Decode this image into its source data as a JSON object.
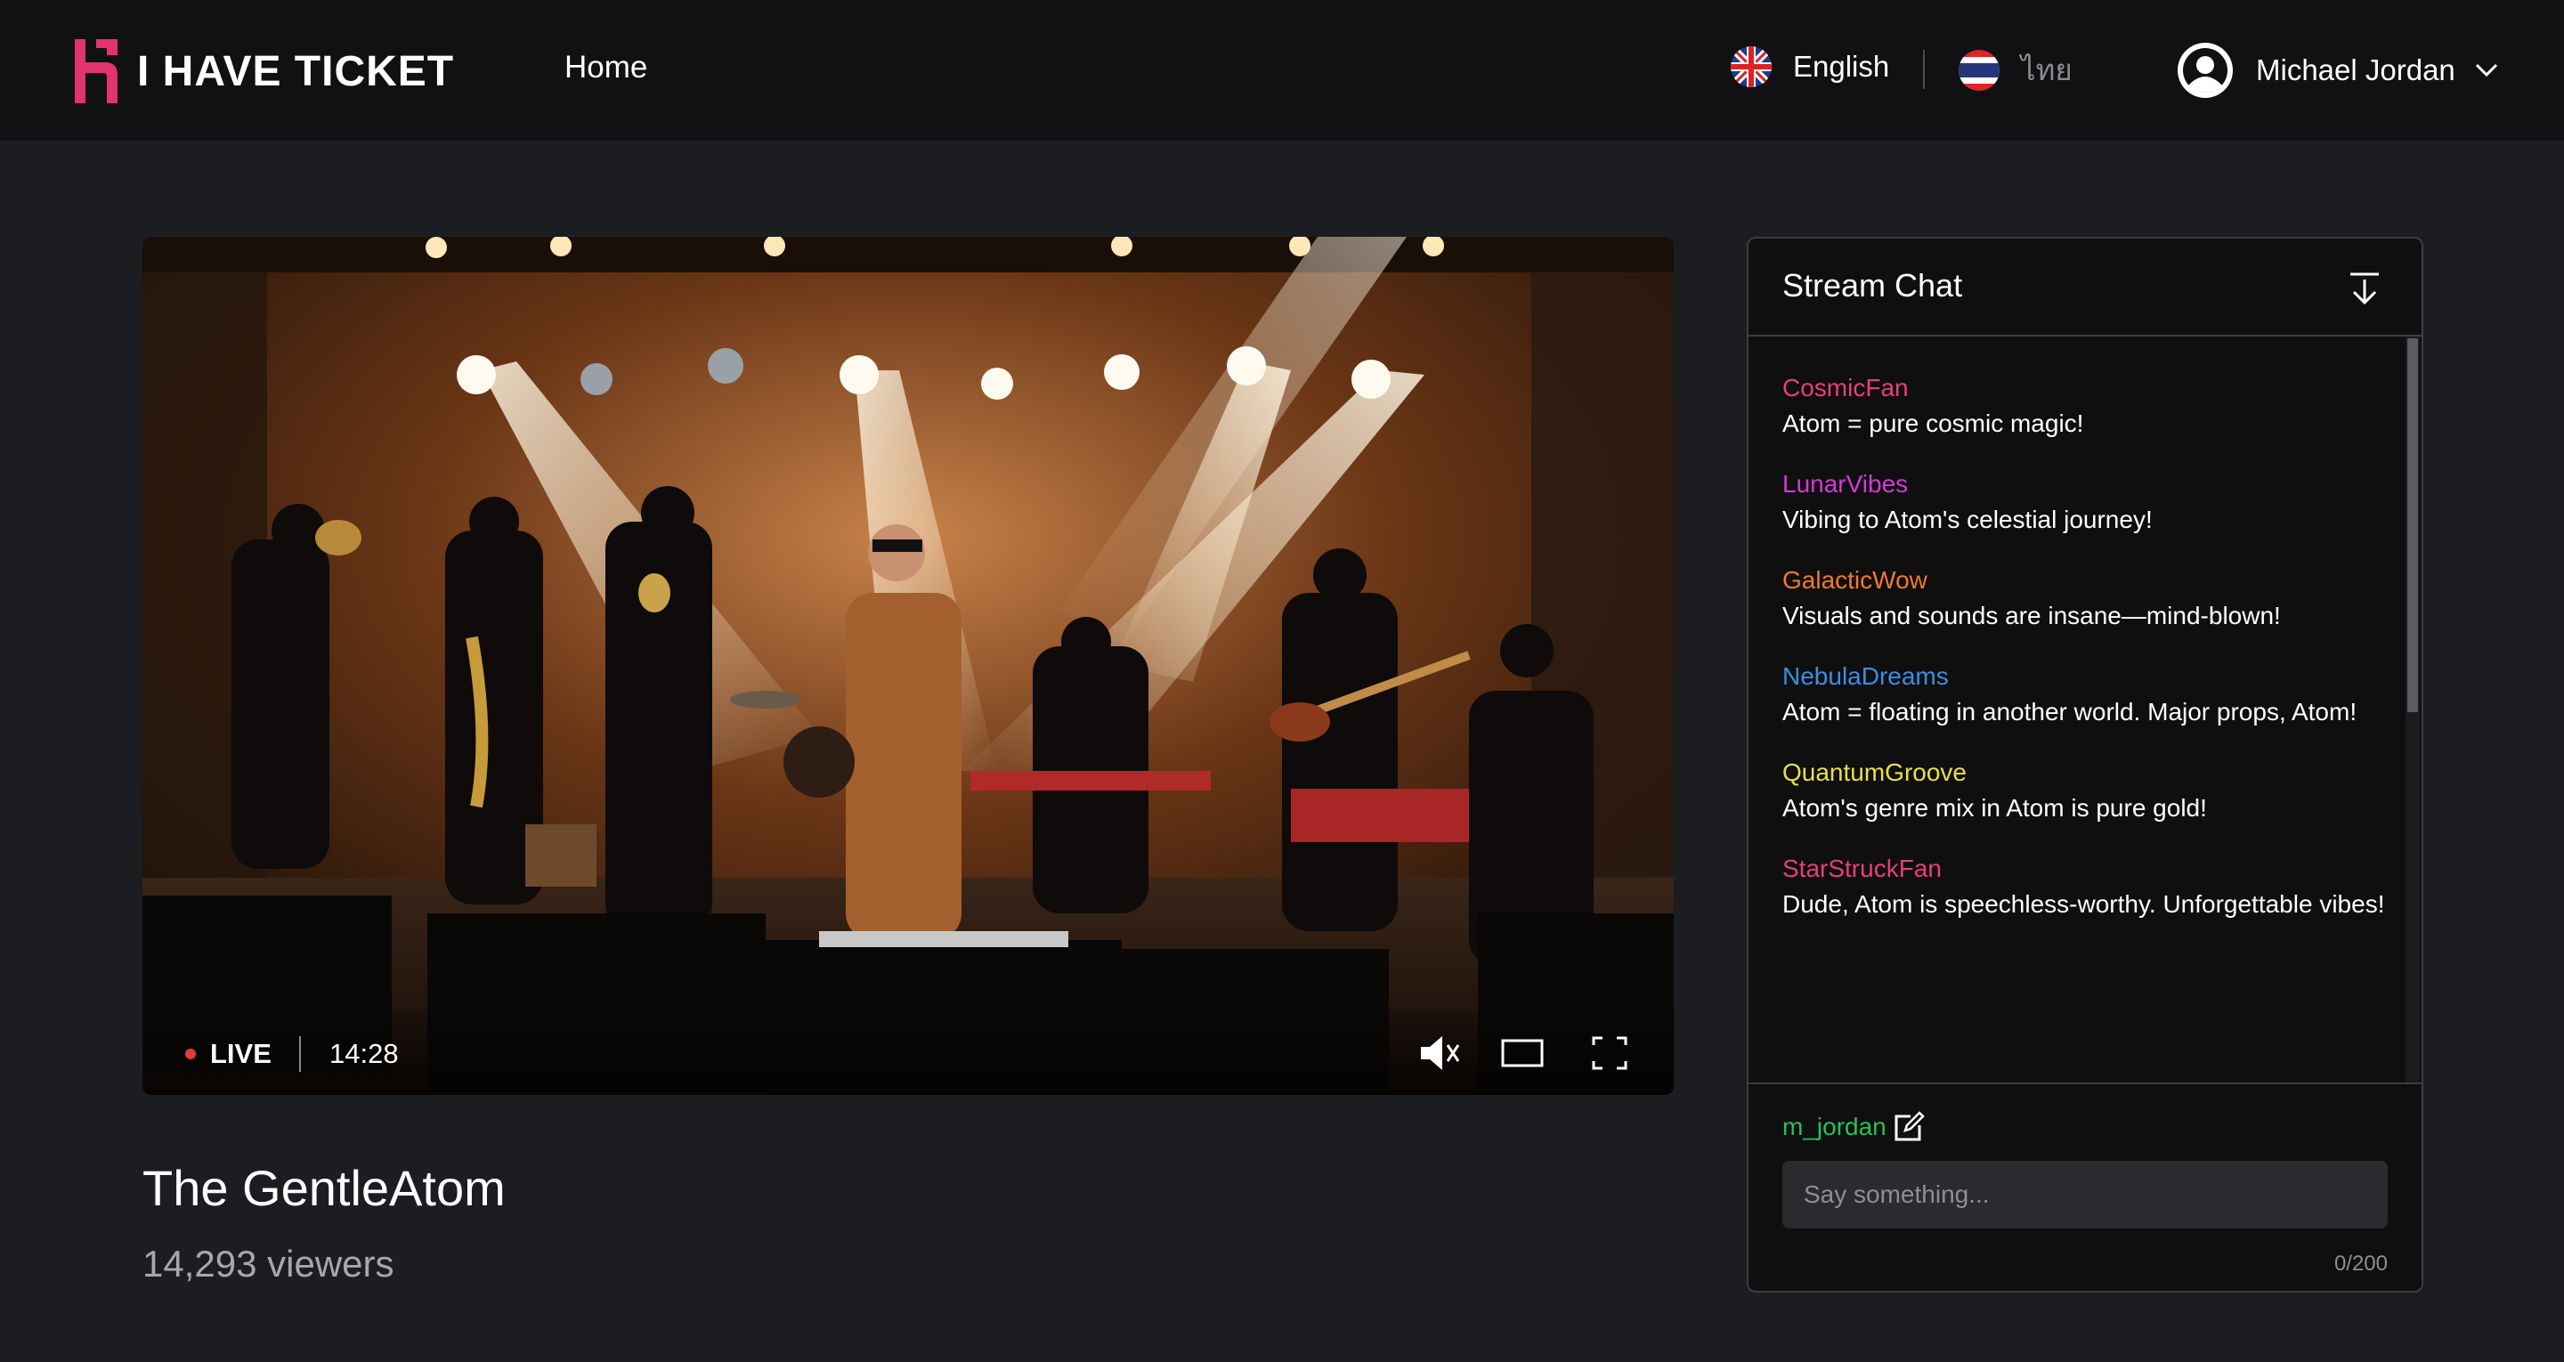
{
  "header": {
    "brand": "I HAVE TICKET",
    "nav_home": "Home",
    "languages": [
      {
        "label": "English",
        "flag": "uk-flag-icon"
      },
      {
        "label": "ไทย",
        "flag": "thailand-flag-icon"
      }
    ],
    "user": {
      "name": "Michael Jordan",
      "avatar": "user-circle-icon",
      "menu": "chevron-down-icon"
    }
  },
  "colors": {
    "brand_pink": "#e0336f",
    "background": "#1c1d21",
    "header": "#111113",
    "live": "#e23a3a",
    "self_user": "#25c254"
  },
  "player": {
    "live_label": "LIVE",
    "elapsed": "14:28",
    "controls": [
      "volume-muted-icon",
      "theater-mode-icon",
      "fullscreen-icon"
    ]
  },
  "stream": {
    "title": "The GentleAtom",
    "viewers": "14,293 viewers"
  },
  "chat": {
    "title": "Stream Chat",
    "collapse_icon": "arrow-down-to-line-icon",
    "messages": [
      {
        "user": "CosmicFan",
        "color": "#e83e7b",
        "text": "Atom = pure cosmic magic!"
      },
      {
        "user": "LunarVibes",
        "color": "#d43ad6",
        "text": "Vibing to Atom's celestial journey!"
      },
      {
        "user": "GalacticWow",
        "color": "#ef7a2e",
        "text": "Visuals and sounds are insane—mind-blown!"
      },
      {
        "user": "NebulaDreams",
        "color": "#3a8fe0",
        "text": "Atom = floating in another world. Major props, Atom!"
      },
      {
        "user": "QuantumGroove",
        "color": "#e6e04a",
        "text": "Atom's genre mix in Atom is pure gold!"
      },
      {
        "user": "StarStruckFan",
        "color": "#e83e7b",
        "text": "Dude, Atom is speechless-worthy. Unforgettable vibes!"
      }
    ],
    "current_user": "m_jordan",
    "input_placeholder": "Say something...",
    "char_counter": "0/200"
  }
}
